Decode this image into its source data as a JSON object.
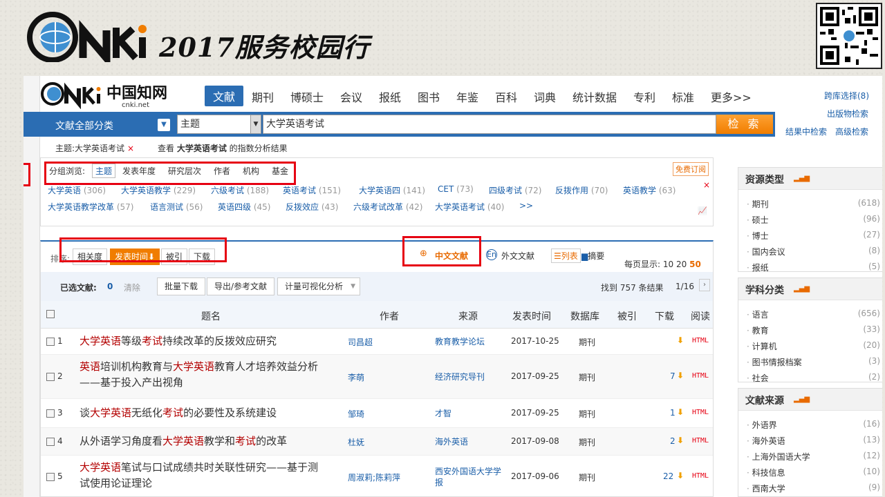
{
  "banner": {
    "title": "2017服务校园行",
    "logo_text": "CNKi"
  },
  "nav": {
    "logo_cn": "中国知网",
    "logo_en": "cnki.net",
    "tabs": [
      "文献",
      "期刊",
      "博硕士",
      "会议",
      "报纸",
      "图书",
      "年鉴",
      "百科",
      "词典",
      "统计数据",
      "专利",
      "标准",
      "更多>>"
    ],
    "cross": "跨库选择(8)",
    "pub_search": "出版物检索",
    "in_result": "结果中检索",
    "advanced": "高级检索"
  },
  "search": {
    "category": "文献全部分类",
    "field": "主题",
    "query": "大学英语考试",
    "button": "检 索"
  },
  "crumb": {
    "topic": "主题:大学英语考试",
    "index_pre": "查看 ",
    "index_kw": "大学英语考试",
    "index_post": " 的指数分析结果"
  },
  "group": {
    "label": "分组浏览:",
    "tabs": [
      "主题",
      "发表年度",
      "研究层次",
      "作者",
      "机构",
      "基金"
    ],
    "free": "免费订阅",
    "topics": [
      [
        "大学英语",
        "(306)"
      ],
      [
        "大学英语教学",
        "(229)"
      ],
      [
        "六级考试",
        "(188)"
      ],
      [
        "英语考试",
        "(151)"
      ],
      [
        "大学英语四",
        "(141)"
      ],
      [
        "CET",
        "(73)"
      ],
      [
        "四级考试",
        "(72)"
      ],
      [
        "反拨作用",
        "(70)"
      ],
      [
        "英语教学",
        "(63)"
      ],
      [
        "大学英语教学改革",
        "(57)"
      ],
      [
        "语言测试",
        "(56)"
      ],
      [
        "英语四级",
        "(45)"
      ],
      [
        "反拨效应",
        "(43)"
      ],
      [
        "六级考试改革",
        "(42)"
      ],
      [
        "大学英语考试",
        "(40)"
      ],
      [
        ">>",
        ""
      ]
    ]
  },
  "sort": {
    "label": "排序:",
    "options": [
      "相关度",
      "发表时间⬇",
      "被引",
      "下载"
    ],
    "zh": "中文文献",
    "en": "外文文献",
    "list": "列表",
    "abstract": "摘要",
    "perpage_label": "每页显示:",
    "perpage": [
      "10",
      "20",
      "50"
    ]
  },
  "selbar": {
    "label": "已选文献:",
    "count": "0",
    "clear": "清除",
    "batch": "批量下载",
    "export": "导出/参考文献",
    "viz": "计量可视化分析",
    "found": "找到 757 条结果",
    "page": "1/16"
  },
  "cols": [
    "题名",
    "作者",
    "来源",
    "发表时间",
    "数据库",
    "被引",
    "下载",
    "阅读"
  ],
  "rows": [
    {
      "n": "1",
      "t1": [
        [
          "大学英语",
          1
        ],
        [
          "等级",
          0
        ],
        [
          "考试",
          1
        ],
        [
          "持续改革的反拨效应研究",
          0
        ]
      ],
      "t2": [],
      "author": "司昌超",
      "source": "教育教学论坛",
      "date": "2017-10-25",
      "db": "期刊",
      "dl": ""
    },
    {
      "n": "2",
      "t1": [
        [
          "英语",
          1
        ],
        [
          "培训机构教育与",
          0
        ],
        [
          "大学英语",
          1
        ],
        [
          "教育人才培养效益分析",
          0
        ]
      ],
      "t2": [
        [
          "——基于投入产出视角",
          0
        ]
      ],
      "author": "李萌",
      "source": "经济研究导刊",
      "date": "2017-09-25",
      "db": "期刊",
      "dl": "7"
    },
    {
      "n": "3",
      "t1": [
        [
          "谈",
          0
        ],
        [
          "大学英语",
          1
        ],
        [
          "无纸化",
          0
        ],
        [
          "考试",
          1
        ],
        [
          "的必要性及系统建设",
          0
        ]
      ],
      "t2": [],
      "author": "邹琦",
      "source": "才智",
      "date": "2017-09-25",
      "db": "期刊",
      "dl": "1"
    },
    {
      "n": "4",
      "t1": [
        [
          "从外语学习角度看",
          0
        ],
        [
          "大学英语",
          1
        ],
        [
          "教学和",
          0
        ],
        [
          "考试",
          1
        ],
        [
          "的改革",
          0
        ]
      ],
      "t2": [],
      "author": "杜妩",
      "source": "海外英语",
      "date": "2017-09-08",
      "db": "期刊",
      "dl": "2"
    },
    {
      "n": "5",
      "t1": [
        [
          "大学英语",
          1
        ],
        [
          "笔试与口试成绩共时关联性研究——基于测",
          0
        ]
      ],
      "t2": [
        [
          "试使用论证理论",
          0
        ]
      ],
      "author": "周淑莉;陈莉萍",
      "source": "西安外国语大学学",
      "source2": "报",
      "date": "2017-09-06",
      "db": "期刊",
      "dl": "22"
    }
  ],
  "panels": [
    {
      "title": "资源类型",
      "items": [
        [
          "期刊",
          "(618)"
        ],
        [
          "硕士",
          "(96)"
        ],
        [
          "博士",
          "(27)"
        ],
        [
          "国内会议",
          "(8)"
        ],
        [
          "报纸",
          "(5)"
        ]
      ]
    },
    {
      "title": "学科分类",
      "items": [
        [
          "语言",
          "(656)"
        ],
        [
          "教育",
          "(33)"
        ],
        [
          "计算机",
          "(20)"
        ],
        [
          "图书情报档案",
          "(3)"
        ],
        [
          "社会",
          "(2)"
        ]
      ]
    },
    {
      "title": "文献来源",
      "items": [
        [
          "外语界",
          "(16)"
        ],
        [
          "海外英语",
          "(13)"
        ],
        [
          "上海外国语大学",
          "(12)"
        ],
        [
          "科技信息",
          "(10)"
        ],
        [
          "西南大学",
          "(9)"
        ]
      ]
    }
  ],
  "colors": {
    "brand": "#2b6db3",
    "orange": "#f07d00",
    "red": "#e60012"
  }
}
